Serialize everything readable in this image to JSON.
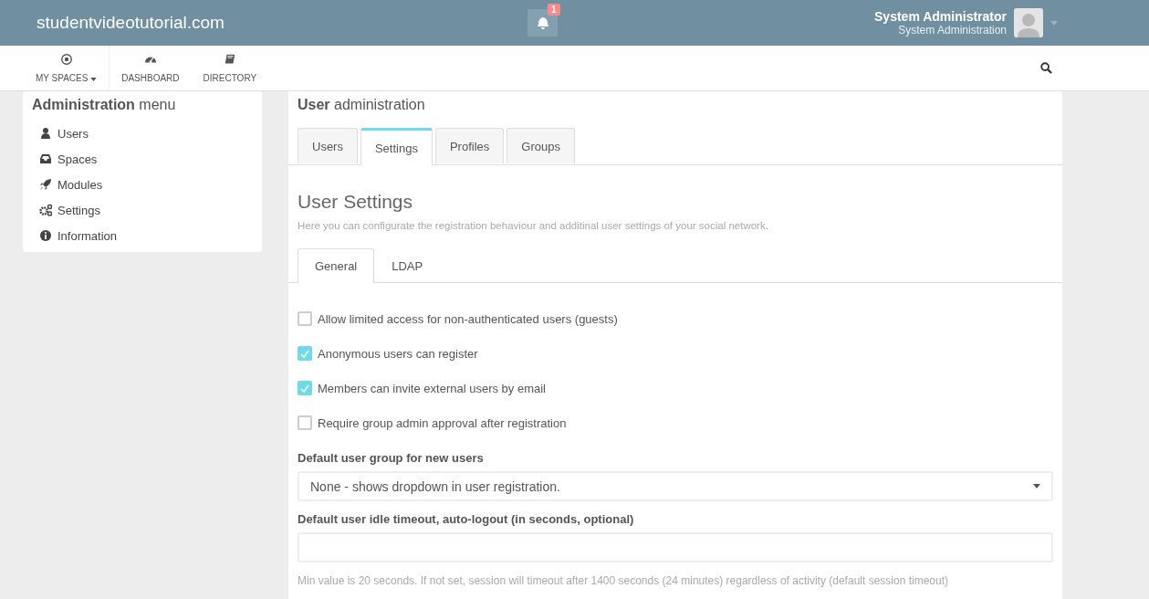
{
  "topbar": {
    "logo": "studentvideotutorial.com",
    "notifications": {
      "count": "1"
    },
    "user": {
      "name": "System Administrator",
      "role": "System Administration"
    }
  },
  "nav": [
    {
      "label": "MY SPACES",
      "dropdown": true
    },
    {
      "label": "DASHBOARD",
      "dropdown": false
    },
    {
      "label": "DIRECTORY",
      "dropdown": false
    }
  ],
  "sidebar": {
    "title": "**Administration** menu",
    "items": [
      "Users",
      "Spaces",
      "Modules",
      "Settings",
      "Information"
    ]
  },
  "main": {
    "title": "**User** administration",
    "tabs": [
      {
        "label": "Users",
        "selected": false
      },
      {
        "label": "Settings",
        "selected": true
      },
      {
        "label": "Profiles",
        "selected": false
      },
      {
        "label": "Groups",
        "selected": false
      }
    ],
    "heading": "User Settings",
    "description": "Here you can configurate the registration behaviour and additinal user settings of your social network.",
    "subtabs": [
      {
        "label": "General",
        "selected": true
      },
      {
        "label": "LDAP",
        "selected": false
      }
    ],
    "checkboxes": [
      {
        "label": "Allow limited access for non-authenticated users (guests)",
        "checked": false
      },
      {
        "label": "Anonymous users can register",
        "checked": true
      },
      {
        "label": "Members can invite external users by email",
        "checked": true
      },
      {
        "label": "Require group admin approval after registration",
        "checked": false
      }
    ],
    "default_group": {
      "label": "Default user group for new users",
      "value": "None - shows dropdown in user registration."
    },
    "idle_timeout": {
      "label": "Default user idle timeout, auto-logout (in seconds, optional)",
      "hint": "Min value is 20 seconds. If not set, session will timeout after 1400 seconds (24 minutes) regardless of activity (default session timeout)"
    }
  }
}
